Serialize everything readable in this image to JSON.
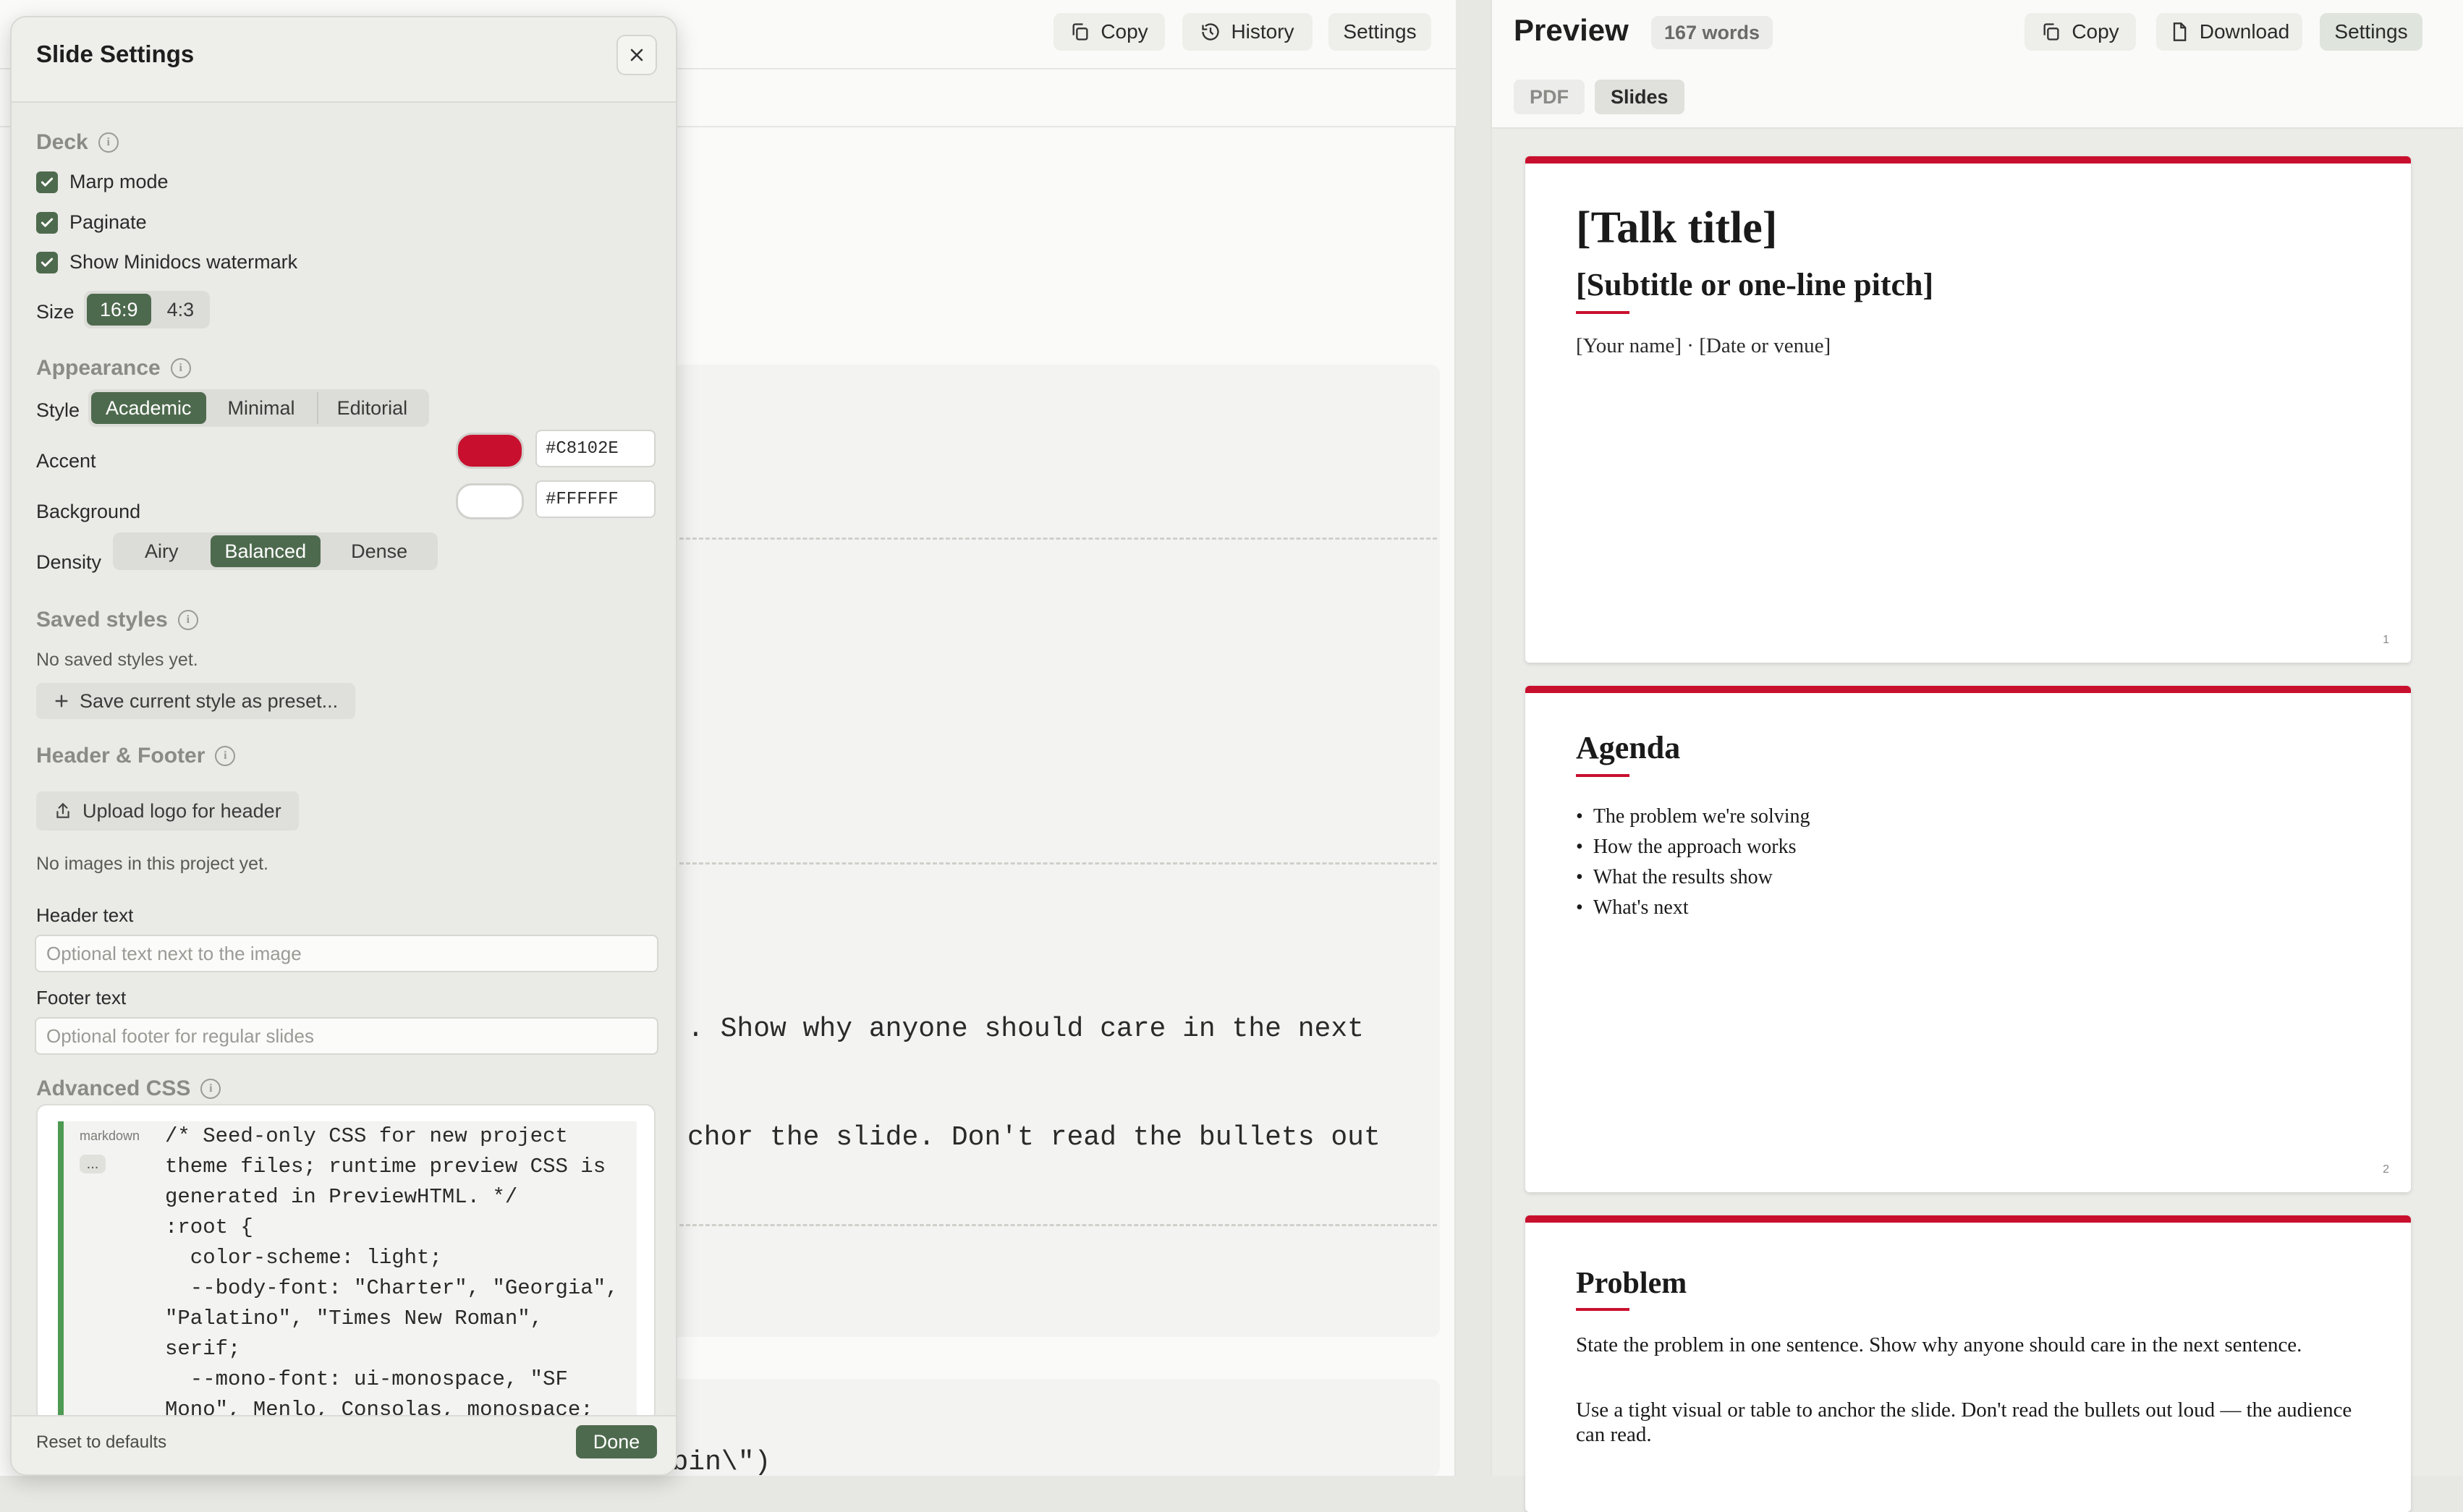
{
  "editor": {
    "toolbar": {
      "copy": "Copy",
      "history": "History",
      "settings": "Settings"
    },
    "lines": [
      ". Show why anyone should care in the next",
      "chor the slide. Don't read the bullets out",
      "weights=\"load_model(\\\"model.bin\\\")"
    ]
  },
  "preview": {
    "title": "Preview",
    "word_count": "167 words",
    "toolbar": {
      "copy": "Copy",
      "download": "Download",
      "settings": "Settings"
    },
    "tabs": [
      {
        "label": "PDF",
        "active": false
      },
      {
        "label": "Slides",
        "active": true
      }
    ],
    "slides": [
      {
        "number": "1",
        "title": "[Talk title]",
        "subtitle": "[Subtitle or one-line pitch]",
        "byline": "[Your name] · [Date or venue]"
      },
      {
        "number": "2",
        "title": "Agenda",
        "bullets": [
          "The problem we're solving",
          "How the approach works",
          "What the results show",
          "What's next"
        ]
      },
      {
        "title": "Problem",
        "para1": "State the problem in one sentence. Show why anyone should care in the next sentence.",
        "para2": "Use a tight visual or table to anchor the slide. Don't read the bullets out loud — the audience can read."
      }
    ]
  },
  "settings": {
    "title": "Slide Settings",
    "deck": {
      "title": "Deck",
      "marp_mode": "Marp mode",
      "paginate": "Paginate",
      "watermark": "Show Minidocs watermark",
      "size_label": "Size",
      "size_options": [
        "16:9",
        "4:3"
      ],
      "size_selected": "16:9"
    },
    "appearance": {
      "title": "Appearance",
      "style_label": "Style",
      "style_options": [
        "Academic",
        "Minimal",
        "Editorial"
      ],
      "style_selected": "Academic",
      "accent_label": "Accent",
      "accent_value": "#C8102E",
      "background_label": "Background",
      "background_value": "#FFFFFF",
      "density_label": "Density",
      "density_options": [
        "Airy",
        "Balanced",
        "Dense"
      ],
      "density_selected": "Balanced"
    },
    "saved": {
      "title": "Saved styles",
      "empty": "No saved styles yet.",
      "save_button": "Save current style as preset..."
    },
    "header_footer": {
      "title": "Header & Footer",
      "upload_button": "Upload logo for header",
      "no_images": "No images in this project yet.",
      "header_label": "Header text",
      "header_placeholder": "Optional text next to the image",
      "footer_label": "Footer text",
      "footer_placeholder": "Optional footer for regular slides"
    },
    "advanced": {
      "title": "Advanced CSS",
      "lang_tag": "markdown",
      "more": "...",
      "code": "/* Seed-only CSS for new project\ntheme files; runtime preview CSS is\ngenerated in PreviewHTML. */\n:root {\n  color-scheme: light;\n  --body-font: \"Charter\", \"Georgia\",\n\"Palatino\", \"Times New Roman\",\nserif;\n  --mono-font: ui-monospace, \"SF\nMono\", Menlo, Consolas, monospace;"
    },
    "footer": {
      "reset": "Reset to defaults",
      "done": "Done"
    }
  },
  "colors": {
    "accent": "#C8102E",
    "primary_green": "#4E6A4E",
    "css_bar": "#4E9A52"
  }
}
